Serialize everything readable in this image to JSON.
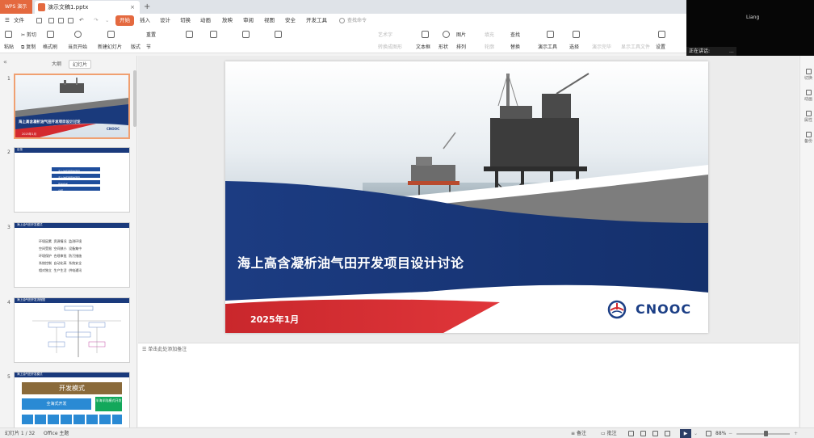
{
  "titlebar": {
    "app_tab": "WPS 演示",
    "doc_tab": "演示文稿1.pptx",
    "new_tab": "+"
  },
  "menu": {
    "file": "文件",
    "items": [
      "开始",
      "插入",
      "设计",
      "切换",
      "动画",
      "放映",
      "审阅",
      "视图",
      "安全",
      "开发工具"
    ],
    "active": "开始",
    "search_placeholder": "查找命令"
  },
  "ribbon": {
    "paste": "粘贴",
    "cut": "剪切",
    "copy": "复制",
    "format_painter": "格式刷",
    "play_from_current": "当页开始",
    "new_slide": "新建幻灯片",
    "layout": "版式",
    "reset": "重置",
    "section": "节",
    "textbox": "文本框",
    "shape": "形状",
    "arrange": "排列",
    "picture": "图片",
    "fill": "填充",
    "outline": "轮廓",
    "find": "查找",
    "replace": "替换",
    "presentation_tools": "演示工具",
    "select": "选择",
    "settings": "设置",
    "convert_shape": "转换成图形",
    "text_effects": "艺术字",
    "dim_1": "演示完毕",
    "dim_2": "显示工具文件"
  },
  "video_overlay": {
    "participant_name": "Liang",
    "speaking_label": "正在讲话:",
    "more": "..."
  },
  "left_panel": {
    "tab_outline": "大纲",
    "tab_slides": "幻灯片",
    "slides": [
      {
        "num": "1",
        "title": "海上高含凝析油气田开发项目设计讨论",
        "date": "2025年1月"
      },
      {
        "num": "2",
        "title": "目录",
        "items": [
          "海上油气田开发项目",
          "海上油气田开发项目",
          "开发模式",
          "总结"
        ]
      },
      {
        "num": "3",
        "title": "海上油气田开发模式",
        "rows": [
          [
            "环境因素",
            "资源情况",
            "监测环境"
          ],
          [
            "空间受限",
            "空间狭小",
            "设备集中"
          ],
          [
            "环境保护",
            "合规审批",
            "防污措施"
          ],
          [
            "系统控制",
            "自动化高",
            "系统安全"
          ],
          [
            "相对独立",
            "生产生活",
            "供电通讯"
          ]
        ]
      },
      {
        "num": "4",
        "title": "海上油气田开发流程图"
      },
      {
        "num": "5",
        "title": "海上油气田开发模式",
        "heading": "开发模式",
        "box1": "全海式开发",
        "box2": "半海半陆模式开发"
      }
    ]
  },
  "slide": {
    "title": "海上高含凝析油气田开发项目设计讨论",
    "date": "2025年1月",
    "logo_text": "CNOOC"
  },
  "notes": {
    "placeholder": "单击此处添加备注"
  },
  "right_sidebar": [
    "切换",
    "动画",
    "属性",
    "备份"
  ],
  "status": {
    "slide_count": "幻灯片 1 / 32",
    "theme": "Office 主题",
    "notes_btn": "备注",
    "comments_btn": "批注",
    "zoom": "88%"
  },
  "colors": {
    "accent": "#e4693f",
    "slide_navy": "#1a3a7c",
    "slide_red": "#d42a2f",
    "slide_gray": "#7d7d7d"
  }
}
